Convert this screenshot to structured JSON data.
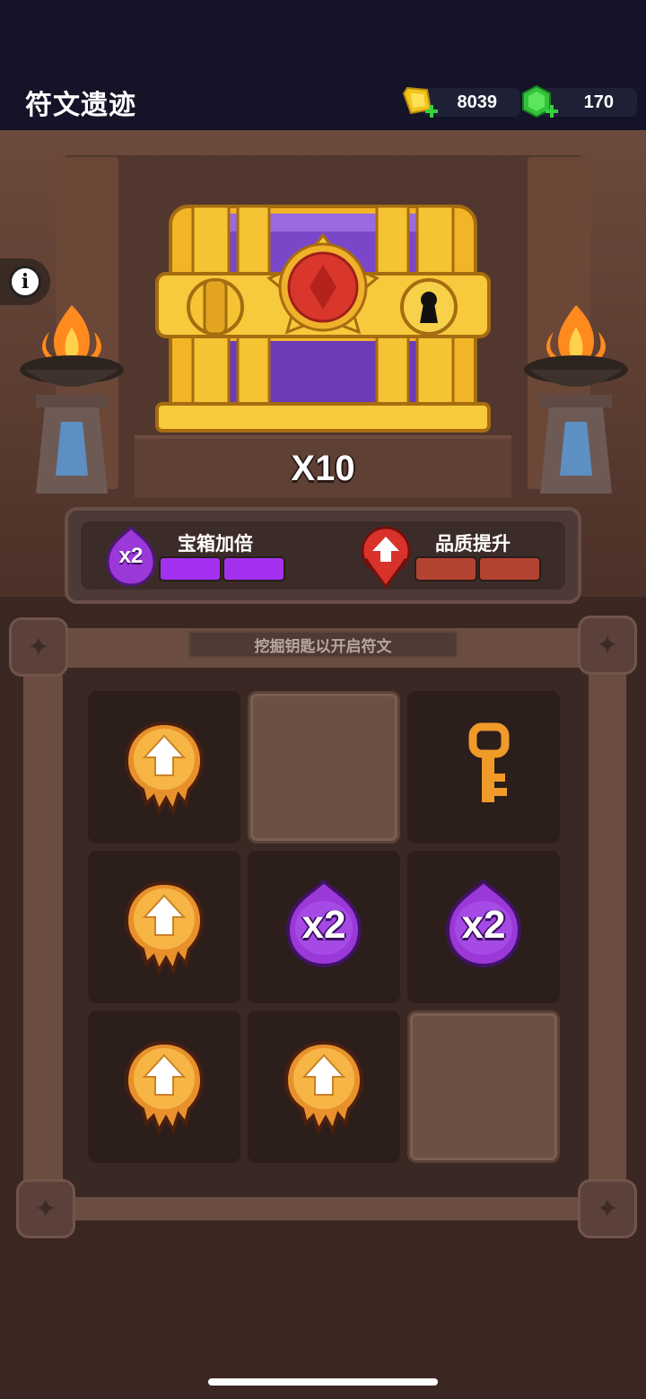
{
  "header": {
    "title": "符文遗迹",
    "currencies": {
      "gold": {
        "amount": "8039",
        "icon": "gold-bar-icon",
        "add_icon": "plus-icon"
      },
      "gem": {
        "amount": "170",
        "icon": "green-gem-icon",
        "add_icon": "plus-icon"
      }
    }
  },
  "info_button": {
    "icon": "info-icon",
    "glyph": "i"
  },
  "chest": {
    "multiplier": "X10"
  },
  "bonuses": [
    {
      "badge": "x2",
      "label": "宝箱加倍",
      "segments": 2,
      "filled": 2,
      "color": "#a431ef",
      "icon": "purple-x2-rune-icon"
    },
    {
      "badge": "",
      "label": "品质提升",
      "segments": 2,
      "filled": 2,
      "color": "#b44332",
      "icon": "red-arrow-rune-icon"
    }
  ],
  "board": {
    "hint": "挖掘钥匙以开启符文",
    "cells": [
      {
        "type": "quality-up",
        "icon": "gold-arrow-rune-icon"
      },
      {
        "type": "dug",
        "icon": ""
      },
      {
        "type": "key",
        "icon": "golden-key-icon"
      },
      {
        "type": "quality-up",
        "icon": "gold-arrow-rune-icon"
      },
      {
        "type": "x2",
        "icon": "purple-x2-rune-icon",
        "text": "x2"
      },
      {
        "type": "x2",
        "icon": "purple-x2-rune-icon",
        "text": "x2"
      },
      {
        "type": "quality-up",
        "icon": "gold-arrow-rune-icon"
      },
      {
        "type": "quality-up",
        "icon": "gold-arrow-rune-icon"
      },
      {
        "type": "dug",
        "icon": ""
      }
    ]
  }
}
